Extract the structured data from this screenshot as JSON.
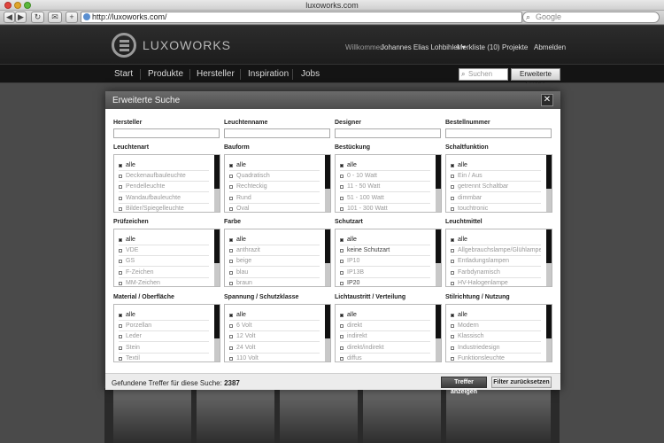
{
  "browser": {
    "window_title": "luxoworks.com",
    "url": "http://luxoworks.com/",
    "search_placeholder": "Google",
    "buttons": [
      "◀",
      "▶",
      "↻",
      "✉",
      "+"
    ]
  },
  "header": {
    "logo_text": "LUXOWORKS",
    "welcome": "Willkommen",
    "user_name": "Johannes Elias Lohbihler ▾",
    "merkliste": "Merkliste (10)",
    "projekte": "Projekte",
    "abmelden": "Abmelden"
  },
  "nav": {
    "items": [
      "Start",
      "Produkte",
      "Hersteller",
      "Inspiration",
      "Jobs"
    ],
    "search_placeholder": "Suchen",
    "advanced_button": "Erweiterte Suche"
  },
  "modal": {
    "title": "Erweiterte Suche",
    "close": "✕",
    "text_fields": [
      "Hersteller",
      "Leuchtenname",
      "Designer",
      "Bestellnummer"
    ],
    "filters": [
      {
        "label": "Leuchtenart",
        "options": [
          "alle",
          "Deckenaufbauleuchte",
          "Pendelleuchte",
          "Wandaufbauleuchte",
          "Bilder/Spiegelleuchte"
        ]
      },
      {
        "label": "Bauform",
        "options": [
          "alle",
          "Quadratisch",
          "Rechteckig",
          "Rund",
          "Oval"
        ]
      },
      {
        "label": "Bestückung",
        "options": [
          "alle",
          "0 - 10 Watt",
          "11 - 50 Watt",
          "51 - 100 Watt",
          "101 - 300 Watt"
        ]
      },
      {
        "label": "Schaltfunktion",
        "options": [
          "alle",
          "Ein / Aus",
          "getrennt Schaltbar",
          "dimmbar",
          "touchtronic"
        ]
      },
      {
        "label": "Prüfzeichen",
        "options": [
          "alle",
          "VDE",
          "GS",
          "F-Zeichen",
          "MM-Zeichen"
        ]
      },
      {
        "label": "Farbe",
        "options": [
          "alle",
          "anthrazit",
          "beige",
          "blau",
          "braun"
        ]
      },
      {
        "label": "Schutzart",
        "options": [
          "alle",
          "keine Schutzart",
          "IP10",
          "IP13B",
          "IP20"
        ]
      },
      {
        "label": "Leuchtmittel",
        "options": [
          "alle",
          "Allgebrauchslampe/Glühlampe",
          "Entladungslampen",
          "Farbdynamisch",
          "HV-Halogenlampe"
        ]
      },
      {
        "label": "Material / Oberfläche",
        "options": [
          "alle",
          "Porzellan",
          "Leder",
          "Stein",
          "Textil"
        ]
      },
      {
        "label": "Spannung / Schutzklasse",
        "options": [
          "alle",
          "6 Volt",
          "12 Volt",
          "24 Volt",
          "110 Volt"
        ]
      },
      {
        "label": "Lichtaustritt / Verteilung",
        "options": [
          "alle",
          "direkt",
          "indirekt",
          "direkt/indirekt",
          "diffus"
        ]
      },
      {
        "label": "Stilrichtung / Nutzung",
        "options": [
          "alle",
          "Modern",
          "Klassisch",
          "Industriedesign",
          "Funktionsleuchte"
        ]
      }
    ],
    "hits_label": "Gefundene Treffer für diese Suche:",
    "hits_count": "2387",
    "show_button": "Treffer anzeigen",
    "reset_button": "Filter zurücksetzen"
  },
  "colors": {
    "header_bg": "#1d1d1d",
    "modal_header": "#555555",
    "accent_dark": "#222222"
  }
}
